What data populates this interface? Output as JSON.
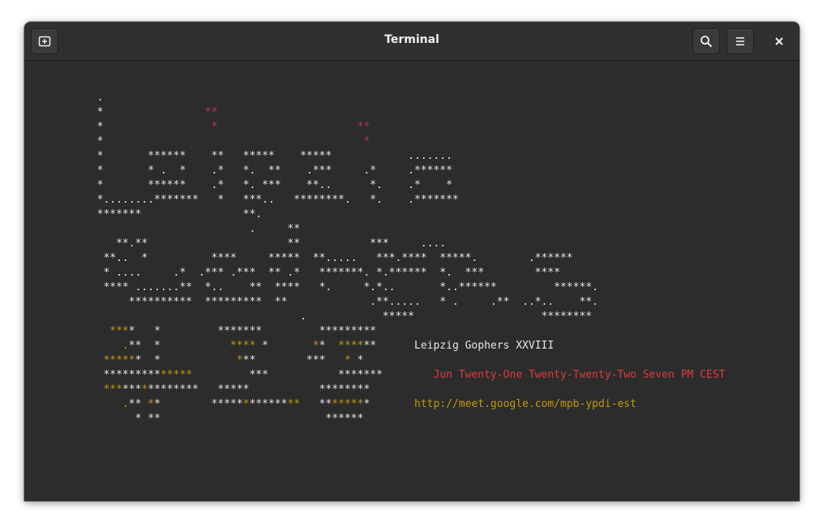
{
  "window": {
    "title": "Terminal"
  },
  "header": {
    "new_tab_icon": "new-tab-icon",
    "search_icon": "search-icon",
    "menu_icon": "hamburger-menu-icon",
    "close_icon": "close-icon"
  },
  "colors": {
    "background": "#2c2c2c",
    "foreground": "#e6e6e6",
    "magenta": "#c2306f",
    "yellow": "#c49a0b",
    "red": "#dc3c3c"
  },
  "terminal": {
    "lines": [
      [
        {
          "t": "        .",
          "c": "w"
        }
      ],
      [
        {
          "t": "        *                ",
          "c": "w"
        },
        {
          "t": "**",
          "c": "m"
        }
      ],
      [
        {
          "t": "        *                 ",
          "c": "w"
        },
        {
          "t": "*",
          "c": "m"
        },
        {
          "t": "                      ",
          "c": "w"
        },
        {
          "t": "**",
          "c": "m"
        }
      ],
      [
        {
          "t": "        *                                         ",
          "c": "w"
        },
        {
          "t": "*",
          "c": "m"
        }
      ],
      [
        {
          "t": "        *       ******    **   *****    *****            .......",
          "c": "w"
        }
      ],
      [
        {
          "t": "        *       * .  *    .*   *.  **    .***     .*     .******",
          "c": "w"
        }
      ],
      [
        {
          "t": "        *       ******    .*   *. ***    **..      *.    .*    *",
          "c": "w"
        }
      ],
      [
        {
          "t": "        *........*******   *   ***..   ********.   *.    .*******",
          "c": "w"
        }
      ],
      [
        {
          "t": "        *******                **.",
          "c": "w"
        }
      ],
      [
        {
          "t": "                                .     **",
          "c": "w"
        }
      ],
      [
        {
          "t": "           **.**                      **           ***     ....",
          "c": "w"
        }
      ],
      [
        {
          "t": "         **..  *          ****     *****  **.....   ***.****  *****.        .******",
          "c": "w"
        }
      ],
      [
        {
          "t": "         * ....     .*  .*** .***  ** .*   *******. *.******  *.  ***        ****",
          "c": "w"
        }
      ],
      [
        {
          "t": "         **** .......**  *..    **  ****   *.     *.*..       *..******         ******.",
          "c": "w"
        }
      ],
      [
        {
          "t": "             **********  *********  **             .**.....   * .     .**  ..*..    **.",
          "c": "w"
        }
      ],
      [
        {
          "t": "                                        .            *****                    ********",
          "c": "w"
        }
      ],
      [
        {
          "t": "          ",
          "c": "w"
        },
        {
          "t": "***",
          "c": "y"
        },
        {
          "t": "*   *         *******         *********",
          "c": "w"
        }
      ],
      [
        {
          "t": "            ",
          "c": "w"
        },
        {
          "t": ".",
          "c": "y"
        },
        {
          "t": "**  *           ",
          "c": "w"
        },
        {
          "t": "****",
          "c": "y"
        },
        {
          "t": " *       ",
          "c": "w"
        },
        {
          "t": "*",
          "c": "y"
        },
        {
          "t": "*  ",
          "c": "w"
        },
        {
          "t": "****",
          "c": "y"
        },
        {
          "t": "**      Leipzig Gophers XXVIII",
          "c": "w"
        }
      ],
      [
        {
          "t": "         ",
          "c": "w"
        },
        {
          "t": "*****",
          "c": "y"
        },
        {
          "t": "*  *            ",
          "c": "w"
        },
        {
          "t": "*",
          "c": "y"
        },
        {
          "t": "**        ***   ",
          "c": "w"
        },
        {
          "t": "*",
          "c": "y"
        },
        {
          "t": " *",
          "c": "w"
        }
      ],
      [
        {
          "t": "         *********",
          "c": "w"
        },
        {
          "t": "*****",
          "c": "y"
        },
        {
          "t": "         ***           *******        ",
          "c": "w"
        },
        {
          "t": "Jun Twenty-One Twenty-Twenty-Two Seven PM CEST",
          "c": "r"
        }
      ],
      [
        {
          "t": "         ",
          "c": "w"
        },
        {
          "t": "***",
          "c": "y"
        },
        {
          "t": "***",
          "c": "w"
        },
        {
          "t": "*",
          "c": "y"
        },
        {
          "t": "********   *****           ********",
          "c": "w"
        }
      ],
      [
        {
          "t": "            ",
          "c": "w"
        },
        {
          "t": ".",
          "c": "y"
        },
        {
          "t": "** ",
          "c": "w"
        },
        {
          "t": "*",
          "c": "y"
        },
        {
          "t": "*        *****",
          "c": "w"
        },
        {
          "t": "*",
          "c": "y"
        },
        {
          "t": "******",
          "c": "w"
        },
        {
          "t": "**",
          "c": "y"
        },
        {
          "t": "   **",
          "c": "w"
        },
        {
          "t": "*****",
          "c": "y"
        },
        {
          "t": "*       ",
          "c": "w"
        },
        {
          "t": "http://meet.google.com/mpb-ypdi-est",
          "c": "y"
        }
      ],
      [
        {
          "t": "              * **                          ******",
          "c": "w"
        }
      ]
    ]
  }
}
